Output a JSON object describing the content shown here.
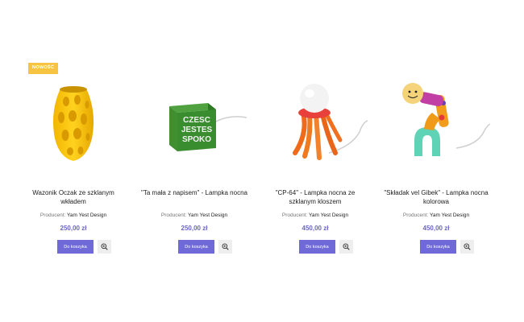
{
  "products": [
    {
      "badge": "NOWOŚĆ",
      "name": "Wazonik Oczak ze szklanym wkładem",
      "producer_label": "Producent:",
      "producer": "Yam Yest Design",
      "price": "250,00 zł",
      "cart_label": "Do koszyka",
      "zoom_icon": "zoom-in-icon"
    },
    {
      "name": "\"Ta mała z napisem\" - Lampka nocna",
      "producer_label": "Producent:",
      "producer": "Yam Yest Design",
      "price": "250,00 zł",
      "cart_label": "Do koszyka",
      "zoom_icon": "zoom-in-icon",
      "image_text": [
        "CZESC",
        "JESTES",
        "SPOKO"
      ]
    },
    {
      "name": "\"CP-64\" - Lampka nocna ze szklanym kloszem",
      "producer_label": "Producent:",
      "producer": "Yam Yest Design",
      "price": "450,00 zł",
      "cart_label": "Do koszyka",
      "zoom_icon": "zoom-in-icon"
    },
    {
      "name": "\"Składak vel Gibek\" - Lampka nocna kolorowa",
      "producer_label": "Producent:",
      "producer": "Yam Yest Design",
      "price": "450,00 zł",
      "cart_label": "Do koszyka",
      "zoom_icon": "zoom-in-icon"
    }
  ],
  "colors": {
    "accent": "#6f6ad8",
    "price": "#6b66c4",
    "badge": "#f6c343"
  }
}
